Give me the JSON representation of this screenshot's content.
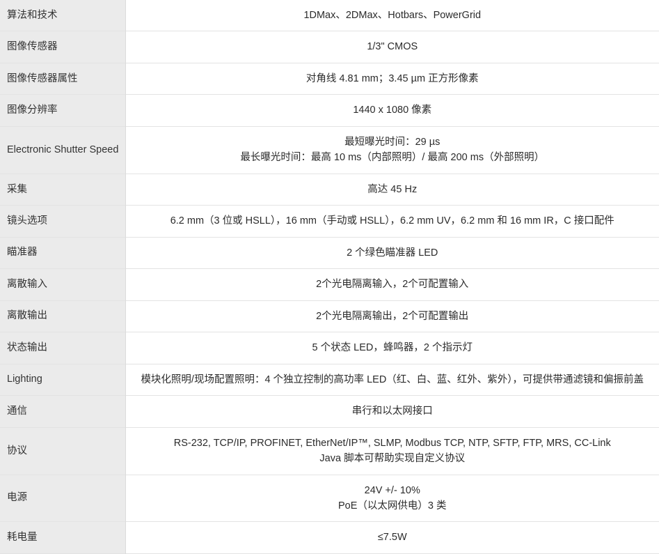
{
  "table": {
    "label_column_header": "",
    "value_column_header": "",
    "rows": [
      {
        "label": "算法和技术",
        "value_lines": [
          "1DMax、2DMax、Hotbars、PowerGrid"
        ]
      },
      {
        "label": "图像传感器",
        "value_lines": [
          "1/3\" CMOS"
        ]
      },
      {
        "label": "图像传感器属性",
        "value_lines": [
          "对角线 4.81 mm；3.45 µm 正方形像素"
        ]
      },
      {
        "label": "图像分辨率",
        "value_lines": [
          "1440 x 1080 像素"
        ]
      },
      {
        "label": "Electronic Shutter Speed",
        "value_lines": [
          "最短曝光时间：29 µs",
          "最长曝光时间：最高 10 ms（内部照明）/ 最高 200 ms（外部照明）"
        ]
      },
      {
        "label": "采集",
        "value_lines": [
          "高达 45 Hz"
        ]
      },
      {
        "label": "镜头选项",
        "value_lines": [
          "6.2 mm（3 位或 HSLL），16 mm（手动或 HSLL），6.2 mm UV，6.2 mm 和 16 mm IR，C 接口配件"
        ]
      },
      {
        "label": "瞄准器",
        "value_lines": [
          "2 个绿色瞄准器 LED"
        ]
      },
      {
        "label": "离散输入",
        "value_lines": [
          "2个光电隔离输入，2个可配置输入"
        ]
      },
      {
        "label": "离散输出",
        "value_lines": [
          "2个光电隔离输出，2个可配置输出"
        ]
      },
      {
        "label": "状态输出",
        "value_lines": [
          "5 个状态 LED，蜂鸣器，2 个指示灯"
        ]
      },
      {
        "label": "Lighting",
        "value_lines": [
          "模块化照明/现场配置照明：4 个独立控制的高功率 LED（红、白、蓝、红外、紫外），可提供带通滤镜和偏振前盖"
        ],
        "wrap": true
      },
      {
        "label": "通信",
        "value_lines": [
          "串行和以太网接口"
        ]
      },
      {
        "label": "协议",
        "value_lines": [
          "RS-232, TCP/IP, PROFINET, EtherNet/IP™, SLMP, Modbus TCP, NTP, SFTP, FTP, MRS, CC-Link",
          "Java 脚本可帮助实现自定义协议"
        ]
      },
      {
        "label": "电源",
        "value_lines": [
          "24V +/- 10%",
          "PoE（以太网供电）3 类"
        ]
      },
      {
        "label": "耗电量",
        "value_lines": [
          "≤7.5W"
        ]
      }
    ]
  }
}
